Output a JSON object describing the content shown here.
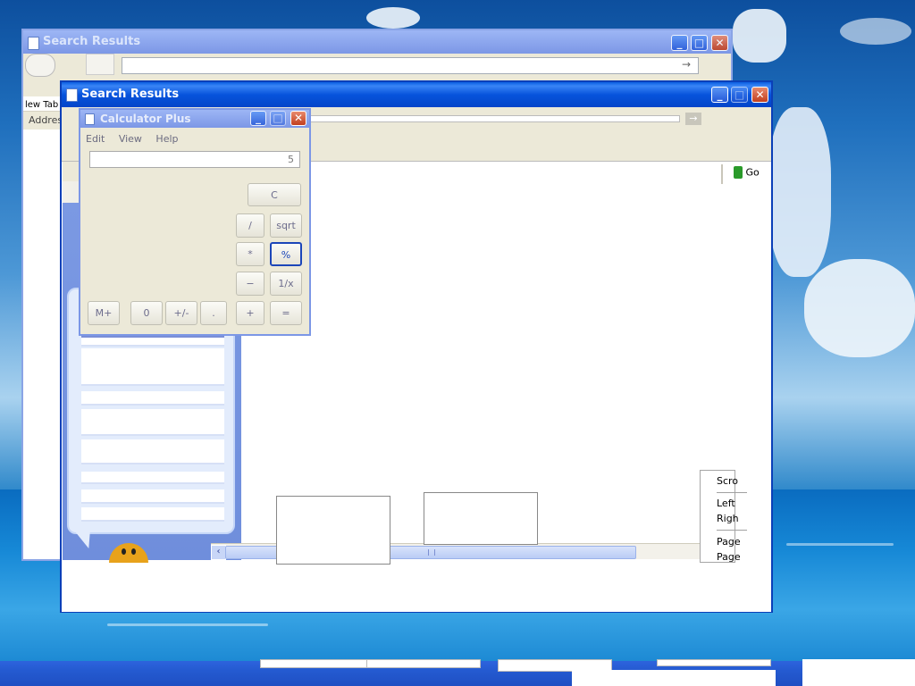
{
  "windows": {
    "back": {
      "title": "Search Results"
    },
    "front": {
      "title": "Search Results"
    }
  },
  "back_window": {
    "tab_label": "lew Tab",
    "address_label": "Addres",
    "go_label": "Go"
  },
  "front_window": {
    "go_label": "Go"
  },
  "calculator": {
    "title": "Calculator Plus",
    "menu": [
      "Edit",
      "View",
      "Help"
    ],
    "display": "5",
    "buttons": {
      "clear": "C",
      "divide": "/",
      "sqrt": "sqrt",
      "multiply": "*",
      "percent": "%",
      "minus": "−",
      "reciprocal": "1/x",
      "plus": "+",
      "equals": "=",
      "mplus": "M+",
      "zero": "0",
      "sign": "+/-",
      "dot": "."
    }
  },
  "scroll_menu": {
    "items": [
      "Scro",
      "Left",
      "Righ",
      "Page",
      "Page"
    ]
  },
  "colors": {
    "title_active": "#0754dc",
    "title_inactive": "#7c97e6",
    "close_red": "#c2401f"
  }
}
